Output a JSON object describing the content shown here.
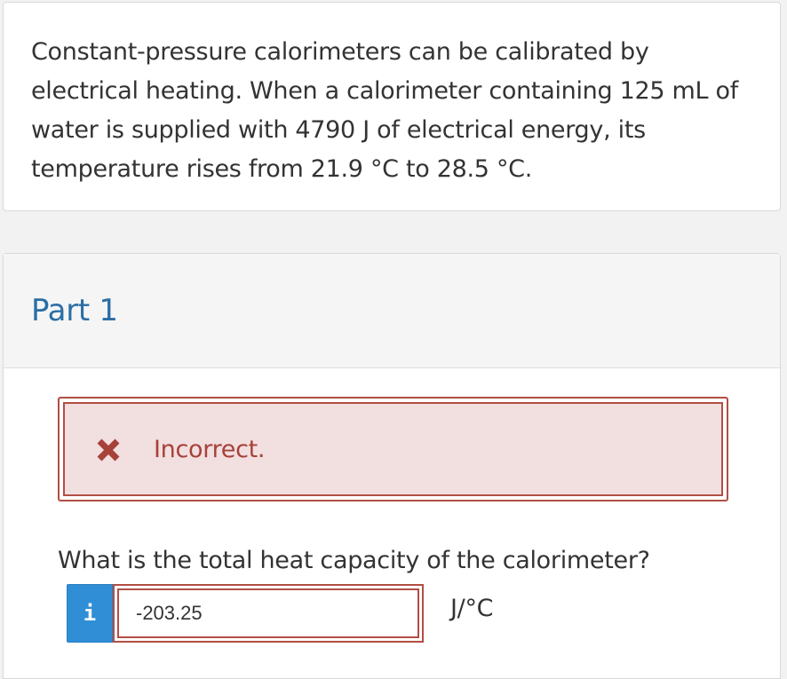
{
  "question": {
    "text": "Constant-pressure calorimeters can be calibrated by electrical heating. When a calorimeter containing 125 mL of water is supplied with 4790 J of electrical energy, its temperature rises from 21.9 °C to 28.5 °C."
  },
  "part": {
    "title": "Part 1",
    "alert": {
      "icon": "x-icon",
      "text": "Incorrect.",
      "border_color": "#b24e44",
      "background_color": "#f2dfdf"
    },
    "prompt": "What is the total heat capacity of the calorimeter?",
    "info_button_label": "i",
    "answer_value": "-203.25",
    "unit": "J/°C"
  },
  "colors": {
    "title_blue": "#2a6ea6",
    "info_blue": "#2f8ed6",
    "error_red": "#b24e44"
  }
}
